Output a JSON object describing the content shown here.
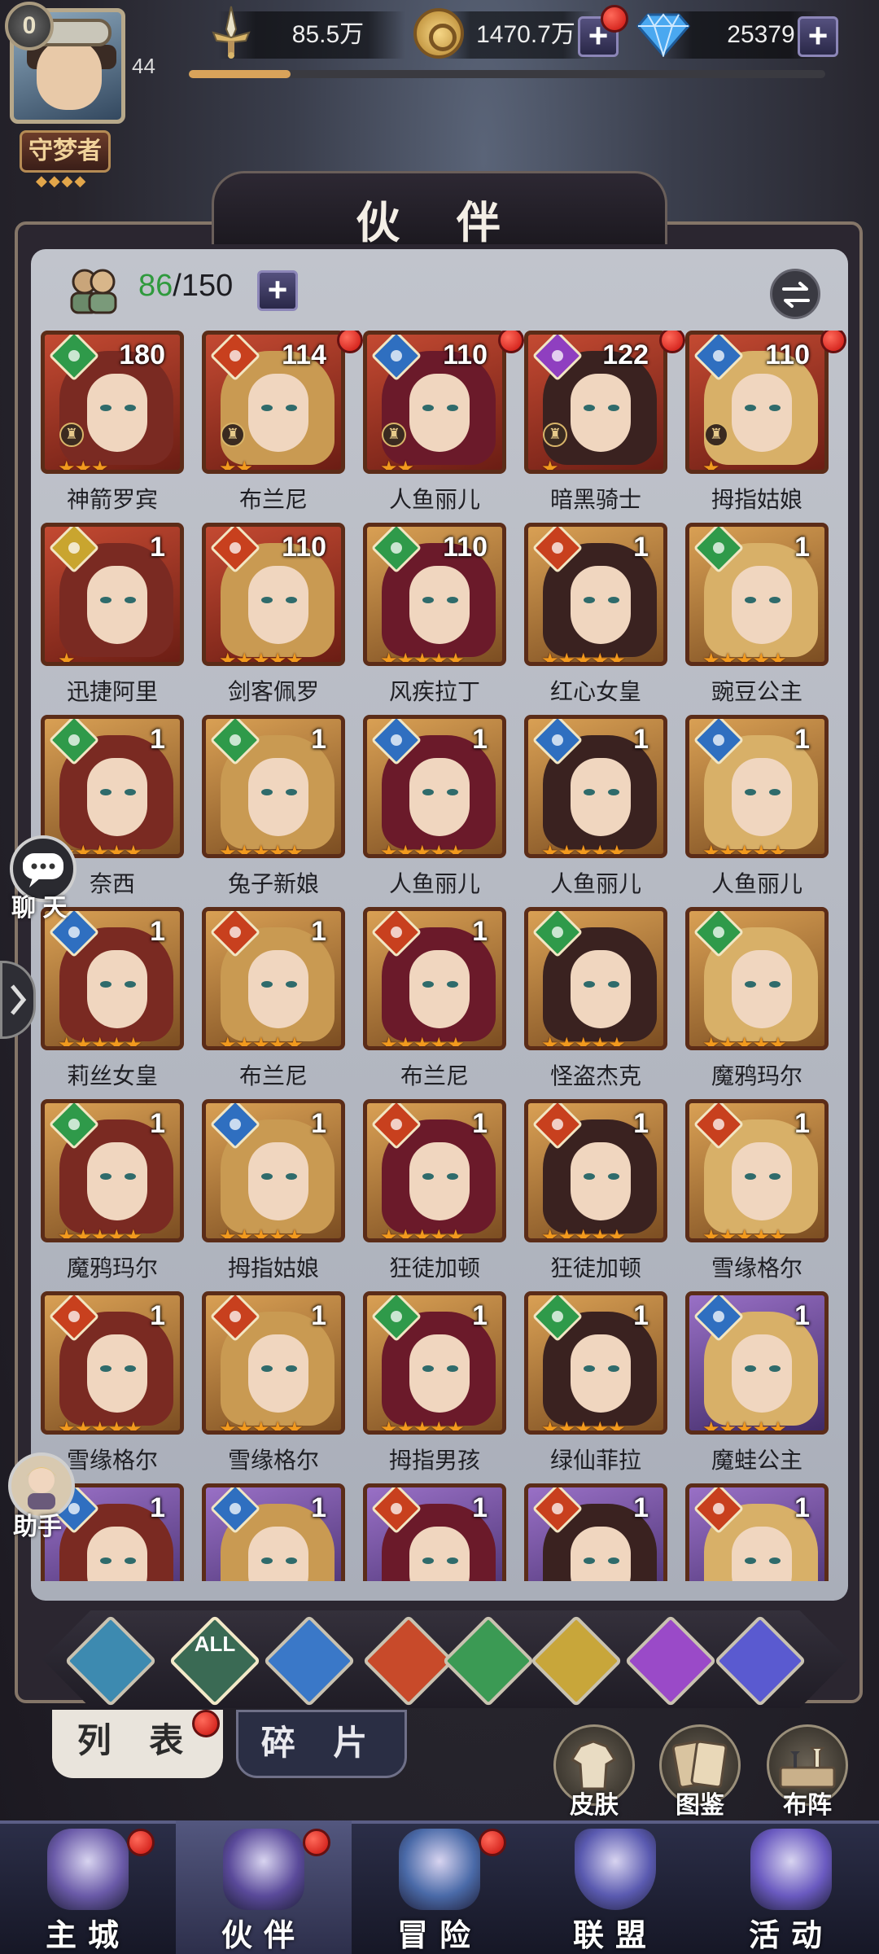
{
  "player": {
    "vip": "0",
    "rank_title": "守梦者",
    "level": "44",
    "xp_progress": 0.16
  },
  "resources": {
    "power": "85.5万",
    "gold": "1470.7万",
    "diamond": "25379"
  },
  "page_title": "伙 伴",
  "hero_count": {
    "current": "86",
    "max": "/150"
  },
  "heroes": [
    {
      "name": "神箭罗宾",
      "level": "180",
      "element": "wind",
      "frame": "red",
      "stars": 3,
      "crown": true,
      "dot": false
    },
    {
      "name": "布兰尼",
      "level": "114",
      "element": "fire",
      "frame": "red",
      "stars": 2,
      "crown": true,
      "dot": true
    },
    {
      "name": "人鱼丽儿",
      "level": "110",
      "element": "water",
      "frame": "red",
      "stars": 2,
      "crown": true,
      "dot": true
    },
    {
      "name": "暗黑骑士",
      "level": "122",
      "element": "dark",
      "frame": "red",
      "stars": 1,
      "crown": true,
      "dot": true
    },
    {
      "name": "拇指姑娘",
      "level": "110",
      "element": "water",
      "frame": "red",
      "stars": 1,
      "crown": true,
      "dot": true
    },
    {
      "name": "迅捷阿里",
      "level": "1",
      "element": "light",
      "frame": "red",
      "stars": 1,
      "crown": false,
      "dot": false
    },
    {
      "name": "剑客佩罗",
      "level": "110",
      "element": "fire",
      "frame": "red",
      "stars": 5,
      "crown": false,
      "dot": false
    },
    {
      "name": "风疾拉丁",
      "level": "110",
      "element": "wind",
      "frame": "gold",
      "stars": 5,
      "crown": false,
      "dot": false
    },
    {
      "name": "红心女皇",
      "level": "1",
      "element": "fire",
      "frame": "gold",
      "stars": 5,
      "crown": false,
      "dot": false
    },
    {
      "name": "豌豆公主",
      "level": "1",
      "element": "wind",
      "frame": "gold",
      "stars": 5,
      "crown": false,
      "dot": false
    },
    {
      "name": "奈西",
      "level": "1",
      "element": "wind",
      "frame": "gold",
      "stars": 5,
      "crown": false,
      "dot": false
    },
    {
      "name": "兔子新娘",
      "level": "1",
      "element": "wind",
      "frame": "gold",
      "stars": 5,
      "crown": false,
      "dot": false
    },
    {
      "name": "人鱼丽儿",
      "level": "1",
      "element": "water",
      "frame": "gold",
      "stars": 5,
      "crown": false,
      "dot": false
    },
    {
      "name": "人鱼丽儿",
      "level": "1",
      "element": "water",
      "frame": "gold",
      "stars": 5,
      "crown": false,
      "dot": false
    },
    {
      "name": "人鱼丽儿",
      "level": "1",
      "element": "water",
      "frame": "gold",
      "stars": 5,
      "crown": false,
      "dot": false
    },
    {
      "name": "莉丝女皇",
      "level": "1",
      "element": "water",
      "frame": "gold",
      "stars": 5,
      "crown": false,
      "dot": false
    },
    {
      "name": "布兰尼",
      "level": "1",
      "element": "fire",
      "frame": "gold",
      "stars": 5,
      "crown": false,
      "dot": false
    },
    {
      "name": "布兰尼",
      "level": "1",
      "element": "fire",
      "frame": "gold",
      "stars": 5,
      "crown": false,
      "dot": false
    },
    {
      "name": "怪盗杰克",
      "level": "",
      "element": "wind",
      "frame": "gold",
      "stars": 5,
      "crown": false,
      "dot": false
    },
    {
      "name": "魔鸦玛尔",
      "level": "",
      "element": "wind",
      "frame": "gold",
      "stars": 5,
      "crown": false,
      "dot": false
    },
    {
      "name": "魔鸦玛尔",
      "level": "1",
      "element": "wind",
      "frame": "gold",
      "stars": 5,
      "crown": false,
      "dot": false
    },
    {
      "name": "拇指姑娘",
      "level": "1",
      "element": "water",
      "frame": "gold",
      "stars": 5,
      "crown": false,
      "dot": false
    },
    {
      "name": "狂徒加顿",
      "level": "1",
      "element": "fire",
      "frame": "gold",
      "stars": 5,
      "crown": false,
      "dot": false
    },
    {
      "name": "狂徒加顿",
      "level": "1",
      "element": "fire",
      "frame": "gold",
      "stars": 5,
      "crown": false,
      "dot": false
    },
    {
      "name": "雪缘格尔",
      "level": "1",
      "element": "fire",
      "frame": "gold",
      "stars": 5,
      "crown": false,
      "dot": false
    },
    {
      "name": "雪缘格尔",
      "level": "1",
      "element": "fire",
      "frame": "gold",
      "stars": 5,
      "crown": false,
      "dot": false
    },
    {
      "name": "雪缘格尔",
      "level": "1",
      "element": "fire",
      "frame": "gold",
      "stars": 5,
      "crown": false,
      "dot": false
    },
    {
      "name": "拇指男孩",
      "level": "1",
      "element": "wind",
      "frame": "gold",
      "stars": 5,
      "crown": false,
      "dot": false
    },
    {
      "name": "绿仙菲拉",
      "level": "1",
      "element": "wind",
      "frame": "gold",
      "stars": 5,
      "crown": false,
      "dot": false
    },
    {
      "name": "魔蛙公主",
      "level": "1",
      "element": "water",
      "frame": "purple",
      "stars": 5,
      "crown": false,
      "dot": false
    },
    {
      "name": "",
      "level": "1",
      "element": "water",
      "frame": "purple",
      "stars": 0,
      "crown": false,
      "dot": false
    },
    {
      "name": "",
      "level": "1",
      "element": "water",
      "frame": "purple",
      "stars": 0,
      "crown": false,
      "dot": false
    },
    {
      "name": "",
      "level": "1",
      "element": "fire",
      "frame": "purple",
      "stars": 0,
      "crown": false,
      "dot": false
    },
    {
      "name": "",
      "level": "1",
      "element": "fire",
      "frame": "purple",
      "stars": 0,
      "crown": false,
      "dot": false
    },
    {
      "name": "",
      "level": "1",
      "element": "fire",
      "frame": "purple",
      "stars": 0,
      "crown": false,
      "dot": false
    }
  ],
  "side": {
    "chat": "聊 天",
    "assistant": "助手"
  },
  "filters": [
    {
      "id": "sky",
      "color": "#3d8ab0",
      "label": ""
    },
    {
      "id": "all",
      "color": "#3a6a54",
      "label": "ALL"
    },
    {
      "id": "water",
      "color": "#3a78c8",
      "label": ""
    },
    {
      "id": "fire",
      "color": "#c84a2a",
      "label": ""
    },
    {
      "id": "wind",
      "color": "#3b9a54",
      "label": ""
    },
    {
      "id": "light",
      "color": "#c8a63a",
      "label": ""
    },
    {
      "id": "dark",
      "color": "#9a4ac8",
      "label": ""
    },
    {
      "id": "cosmos",
      "color": "#5a5ad0",
      "label": ""
    }
  ],
  "subtabs": {
    "list": "列 表",
    "shards": "碎 片"
  },
  "right_buttons": {
    "skins": "皮肤",
    "gallery": "图鉴",
    "formation": "布阵"
  },
  "nav": [
    {
      "label": "主城",
      "dot": true,
      "active": false
    },
    {
      "label": "伙伴",
      "dot": true,
      "active": true
    },
    {
      "label": "冒险",
      "dot": true,
      "active": false
    },
    {
      "label": "联盟",
      "dot": false,
      "active": false
    },
    {
      "label": "活动",
      "dot": false,
      "active": false
    }
  ],
  "element_colors": {
    "wind": "#2f9a4a",
    "fire": "#c8401e",
    "water": "#2f6fc0",
    "dark": "#8f3fc0",
    "light": "#c9a52f"
  },
  "hair_colors": [
    "#7a2a22",
    "#c99a52",
    "#6b1a2a",
    "#3a2220",
    "#d8b068"
  ]
}
